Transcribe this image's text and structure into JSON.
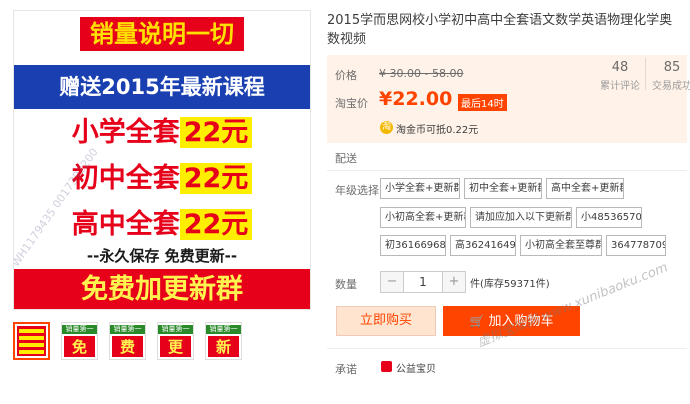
{
  "promo": {
    "line1": "销量说明一切",
    "line2": "赠送2015年最新课程",
    "row1_prefix": "小学全套",
    "row1_price": "22元",
    "row2_prefix": "初中全套",
    "row2_price": "22元",
    "row3_prefix": "高中全套",
    "row3_price": "22元",
    "slogan": "--永久保存  免费更新--",
    "bottom": "免费加更新群",
    "watermark": "WH1179435 0017392200"
  },
  "thumbs": [
    {
      "top": "",
      "char": ""
    },
    {
      "top": "销量第一",
      "char": "免"
    },
    {
      "top": "销量第一",
      "char": "费"
    },
    {
      "top": "销量第一",
      "char": "更"
    },
    {
      "top": "销量第一",
      "char": "新"
    }
  ],
  "product": {
    "title": "2015学而思网校小学初中高中全套语文数学英语物理化学奥数视频",
    "price_label": "价格",
    "orig_price": "¥ 30.00 - 58.00",
    "sale_label": "淘宝价",
    "sale_price": "¥22.00",
    "sale_tag": "最后14时",
    "reviews_count": "48",
    "reviews_label": "累计评论",
    "deals_count": "85",
    "deals_label": "交易成功",
    "coin_icon": "淘",
    "coin_text": "淘金币可抵0.22元",
    "delivery_label": "配送",
    "grade_label": "年级选择",
    "options": [
      "小学全套+更新群",
      "初中全套+更新群",
      "高中全套+更新群",
      "小初高全套+更新群",
      "请加应加入以下更新群",
      "小485365705",
      "初361669683",
      "高362416496",
      "小初高全套至尊群",
      "364778709"
    ],
    "qty_label": "数量",
    "qty_minus": "−",
    "qty_value": "1",
    "qty_plus": "+",
    "stock": "件(库存59371件)",
    "buy_label": "立即购买",
    "cart_label": "加入购物车",
    "promise_label": "承诺",
    "charity": "公益宝贝"
  },
  "site_watermark": "www.xunibaoku.com",
  "site_watermark2": "虚拟宝库网",
  "colors": {
    "accent": "#ff4400",
    "promo_red": "#e6001a",
    "promo_yellow": "#ffee00",
    "promo_blue": "#1a3fb0"
  }
}
